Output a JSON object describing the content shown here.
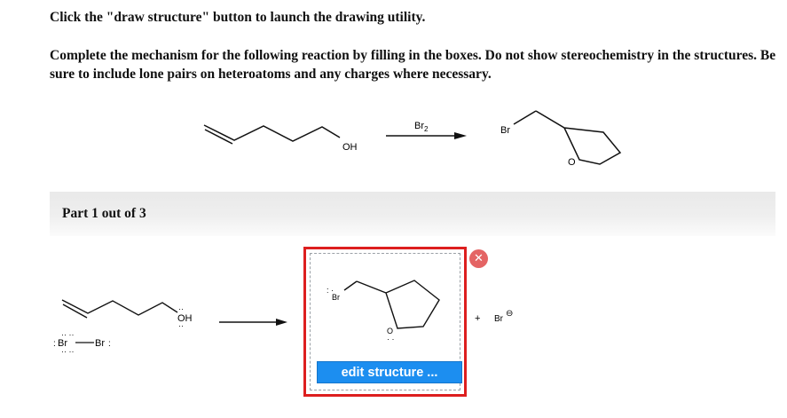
{
  "instructions": {
    "line1": "Click the \"draw structure\" button to launch the drawing utility.",
    "line2": "Complete the mechanism for the following reaction by filling in the boxes. Do not show stereochemistry in the structures. Be sure to include lone pairs on heteroatoms and any charges where necessary."
  },
  "reaction": {
    "reactant_group": "OH",
    "reagent_prefix": "Br",
    "reagent_subscript": "2",
    "product_substituent": "Br",
    "product_ring_atom": "O"
  },
  "part": {
    "label": "Part 1 out of 3"
  },
  "mechanism": {
    "alkenol_group": "OH",
    "bromine_left_atom": "Br",
    "bromine_right_atom": "Br",
    "intermediate_atom": "Br",
    "intermediate_ring_atom": "O",
    "plus_sign": "+",
    "bromide_atom": "Br",
    "bromide_charge": "⊖"
  },
  "answer_box": {
    "edit_button_label": "edit structure ...",
    "close_icon": "close-icon"
  },
  "colors": {
    "box_border": "#dd1f1f",
    "edit_button": "#1c8ef0",
    "close_button": "#e46464"
  }
}
